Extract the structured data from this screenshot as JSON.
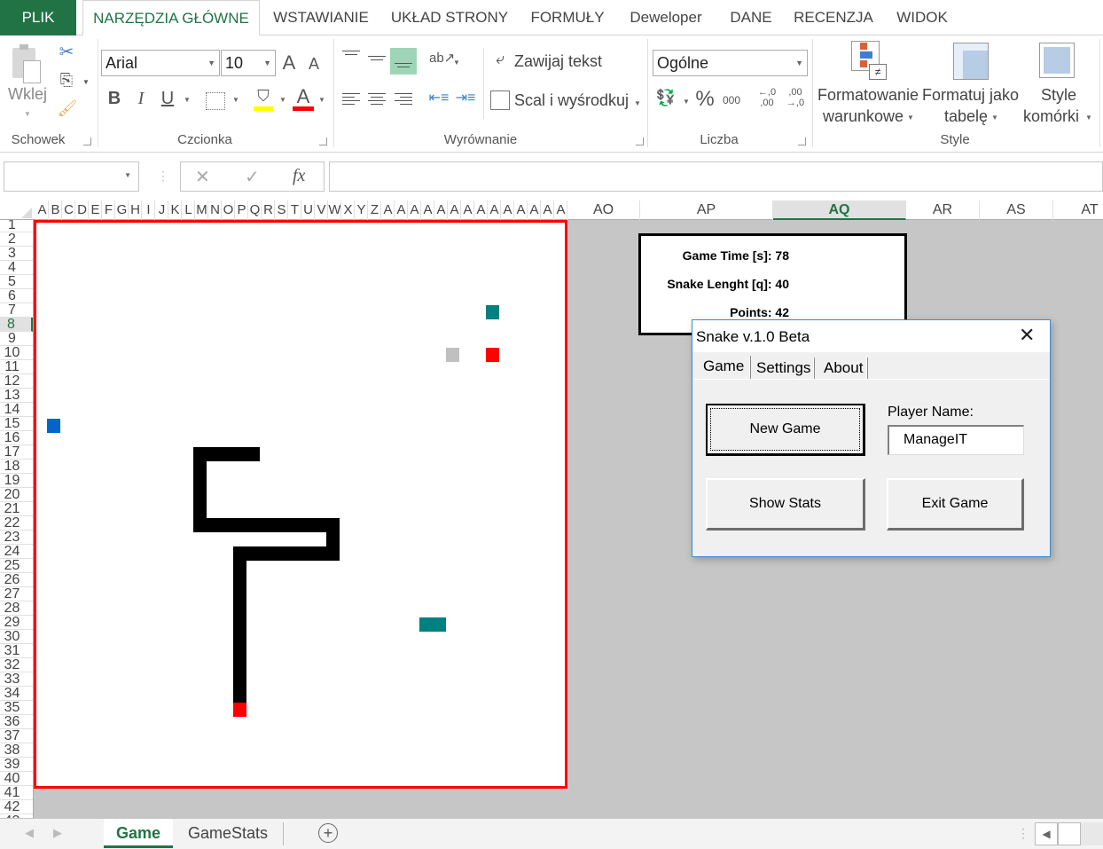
{
  "ribbon_tabs": [
    "PLIK",
    "NARZĘDZIA GŁÓWNE",
    "WSTAWIANIE",
    "UKŁAD STRONY",
    "FORMUŁY",
    "Deweloper",
    "DANE",
    "RECENZJA",
    "WIDOK"
  ],
  "ribbon": {
    "clipboard": {
      "paste_label": "Wklej",
      "group_label": "Schowek"
    },
    "font": {
      "font_name": "Arial",
      "font_size": "10",
      "group_label": "Czcionka",
      "bold": "B",
      "italic": "I",
      "underline": "U",
      "fill_color": "#ffff00",
      "font_color": "#ff0000"
    },
    "alignment": {
      "wrap_text": "Zawijaj tekst",
      "merge_center": "Scal i wyśrodkuj",
      "group_label": "Wyrównanie"
    },
    "number": {
      "format": "Ogólne",
      "percent": "%",
      "thousands": "000",
      "inc_decimal": ",0\n,00",
      "dec_decimal": ",00\n,0",
      "group_label": "Liczba"
    },
    "styles": {
      "conditional_l1": "Formatowanie",
      "conditional_l2": "warunkowe",
      "format_table_l1": "Formatuj jako",
      "format_table_l2": "tabelę",
      "cell_styles_l1": "Style",
      "cell_styles_l2": "komórki",
      "group_label": "Style"
    }
  },
  "formula_bar": {
    "name_box": "",
    "cancel": "✕",
    "enter": "✓",
    "fx": "fx",
    "formula": ""
  },
  "columns": {
    "narrow": [
      "A",
      "B",
      "C",
      "D",
      "E",
      "F",
      "G",
      "H",
      "I",
      "J",
      "K",
      "L",
      "M",
      "N",
      "O",
      "P",
      "Q",
      "R",
      "S",
      "T",
      "U",
      "V",
      "W",
      "X",
      "Y",
      "Z",
      "A",
      "A",
      "A",
      "A",
      "A",
      "A",
      "A",
      "A",
      "A",
      "A",
      "A",
      "A",
      "A",
      "A"
    ],
    "wide": [
      "AO",
      "AP",
      "AQ",
      "AR",
      "AS",
      "AT"
    ],
    "selected": "AQ"
  },
  "rows": {
    "count": 42,
    "selected": 8
  },
  "game": {
    "board_border_color": "#ff0000",
    "snake_color": "#000000",
    "head_color": "#ff0000",
    "snake_body_cells": [
      [
        13,
        17
      ],
      [
        14,
        17
      ],
      [
        15,
        17
      ],
      [
        16,
        17
      ],
      [
        17,
        17
      ],
      [
        13,
        18
      ],
      [
        13,
        19
      ],
      [
        13,
        20
      ],
      [
        13,
        21
      ],
      [
        13,
        22
      ],
      [
        14,
        22
      ],
      [
        15,
        22
      ],
      [
        16,
        22
      ],
      [
        17,
        22
      ],
      [
        18,
        22
      ],
      [
        19,
        22
      ],
      [
        20,
        22
      ],
      [
        21,
        22
      ],
      [
        22,
        22
      ],
      [
        23,
        22
      ],
      [
        23,
        23
      ],
      [
        23,
        24
      ],
      [
        22,
        24
      ],
      [
        21,
        24
      ],
      [
        20,
        24
      ],
      [
        19,
        24
      ],
      [
        18,
        24
      ],
      [
        17,
        24
      ],
      [
        16,
        24
      ],
      [
        16,
        25
      ],
      [
        16,
        26
      ],
      [
        16,
        27
      ],
      [
        16,
        28
      ],
      [
        16,
        29
      ],
      [
        16,
        30
      ],
      [
        16,
        31
      ],
      [
        16,
        32
      ],
      [
        16,
        33
      ],
      [
        16,
        34
      ]
    ],
    "snake_head": [
      16,
      35
    ],
    "items": [
      {
        "type": "teal",
        "color": "#008080",
        "col": 35,
        "row": 7,
        "w": 1
      },
      {
        "type": "gray",
        "color": "#c0c0c0",
        "col": 32,
        "row": 10,
        "w": 1
      },
      {
        "type": "red",
        "color": "#ff0000",
        "col": 35,
        "row": 10,
        "w": 1
      },
      {
        "type": "blue",
        "color": "#0066cc",
        "col": 2,
        "row": 15,
        "w": 1
      },
      {
        "type": "teal",
        "color": "#008080",
        "col": 30,
        "row": 29,
        "w": 2
      }
    ]
  },
  "stats": {
    "game_time": "Game Time [s]: 78",
    "snake_length": "Snake Lenght [q]: 40",
    "points": "Points: 42"
  },
  "dialog": {
    "title": "Snake v.1.0 Beta",
    "close": "✕",
    "tabs": [
      "Game",
      "Settings",
      "About"
    ],
    "active_tab": "Game",
    "new_game": "New Game",
    "player_name_label": "Player Name:",
    "player_name_value": "ManageIT",
    "show_stats": "Show Stats",
    "exit_game": "Exit Game"
  },
  "sheets": {
    "tabs": [
      "Game",
      "GameStats"
    ],
    "active": "Game",
    "add": "+"
  }
}
